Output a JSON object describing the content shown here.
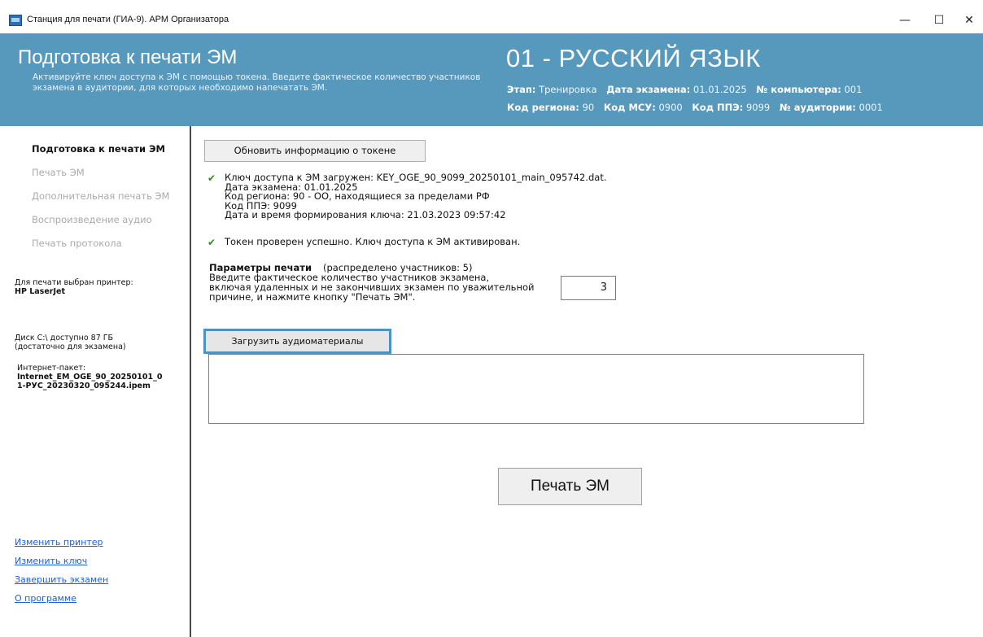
{
  "window": {
    "title": "Станция для печати (ГИА-9). АРМ Организатора",
    "minimize": "—",
    "maximize": "☐",
    "close": "✕"
  },
  "header": {
    "title": "Подготовка к печати ЭМ",
    "description_line1": "Активируйте ключ доступа к ЭМ с помощью токена. Введите фактическое количество участников",
    "description_line2": "экзамена в аудитории, для которых необходимо напечатать ЭМ.",
    "subject": "01 - РУССКИЙ ЯЗЫК",
    "stage_label": "Этап:",
    "stage_value": "Тренировка",
    "exam_date_label": "Дата экзамена:",
    "exam_date_value": "01.01.2025",
    "computer_label": "№ компьютера:",
    "computer_value": "001",
    "region_label": "Код региона:",
    "region_value": "90",
    "msu_label": "Код МСУ:",
    "msu_value": "0900",
    "ppe_label": "Код ППЭ:",
    "ppe_value": "9099",
    "room_label": "№ аудитории:",
    "room_value": "0001"
  },
  "sidebar": {
    "items": [
      {
        "label": "Подготовка к печати ЭМ",
        "active": true
      },
      {
        "label": "Печать ЭМ",
        "active": false
      },
      {
        "label": "Дополнительная печать ЭМ",
        "active": false
      },
      {
        "label": "Воспроизведение аудио",
        "active": false
      },
      {
        "label": "Печать протокола",
        "active": false
      }
    ],
    "printer_label": "Для печати выбран принтер:",
    "printer_name": "HP LaserJet",
    "disk_line1": "Диск C:\\ доступно 87 ГБ",
    "disk_line2": "(достаточно для экзамена)",
    "package_label": "Интернет-пакет:",
    "package_line1": "Internet_EM_OGE_90_20250101_0",
    "package_line2": "1-РУС_20230320_095244.ipem",
    "links": {
      "change_printer": "Изменить принтер",
      "change_key": "Изменить ключ",
      "finish_exam": "Завершить экзамен",
      "about": "О программе"
    }
  },
  "main": {
    "refresh_token_button": "Обновить информацию о токене",
    "key_loaded_line": "Ключ доступа к ЭМ загружен: KEY_OGE_90_9099_20250101_main_095742.dat.",
    "key_exam_date": "Дата экзамена: 01.01.2025",
    "key_region": "Код региона: 90 - ОО, находящиеся за пределами РФ",
    "key_ppe": "Код ППЭ: 9099",
    "key_created": "Дата и время формирования ключа: 21.03.2023 09:57:42",
    "token_ok_line": "Токен проверен успешно. Ключ доступа к ЭМ активирован.",
    "params_title": "Параметры печати",
    "params_note": "(распределено участников: 5)",
    "params_line1": "Введите фактическое количество участников экзамена,",
    "params_line2": "включая удаленных и не закончивших экзамен по уважительной",
    "params_line3": "причине, и нажмите кнопку \"Печать ЭМ\".",
    "participant_count": "3",
    "load_audio_button": "Загрузить аудиоматериалы",
    "print_button": "Печать ЭМ",
    "check_icon": "✔"
  }
}
